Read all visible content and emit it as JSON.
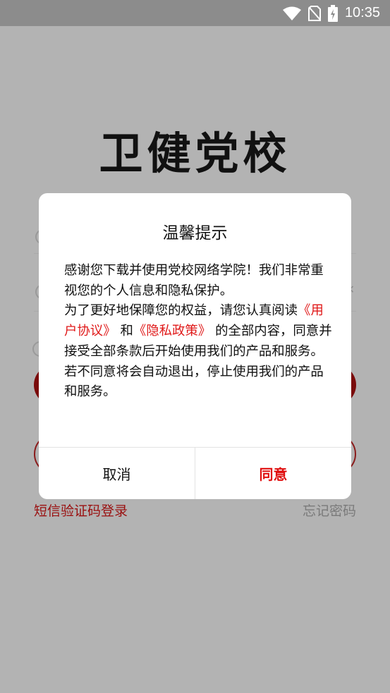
{
  "status_bar": {
    "time": "10:35"
  },
  "app": {
    "logo_text": "卫健党校"
  },
  "links": {
    "sms_login": "短信验证码登录",
    "forgot_password": "忘记密码"
  },
  "dialog": {
    "title": "温馨提示",
    "line1": "感谢您下载并使用党校网络学院！我们非常重视您的个人信息和隐私保护。",
    "line2_prefix": "为了更好地保障您的权益，请您认真阅读",
    "user_agreement": "《用户协议》",
    "and": "和",
    "privacy_policy": "《隐私政策》",
    "line2_suffix": "的全部内容，同意并接受全部条款后开始使用我们的产品和服务。",
    "line3": "若不同意将会自动退出，停止使用我们的产品和服务。",
    "cancel": "取消",
    "agree": "同意"
  }
}
